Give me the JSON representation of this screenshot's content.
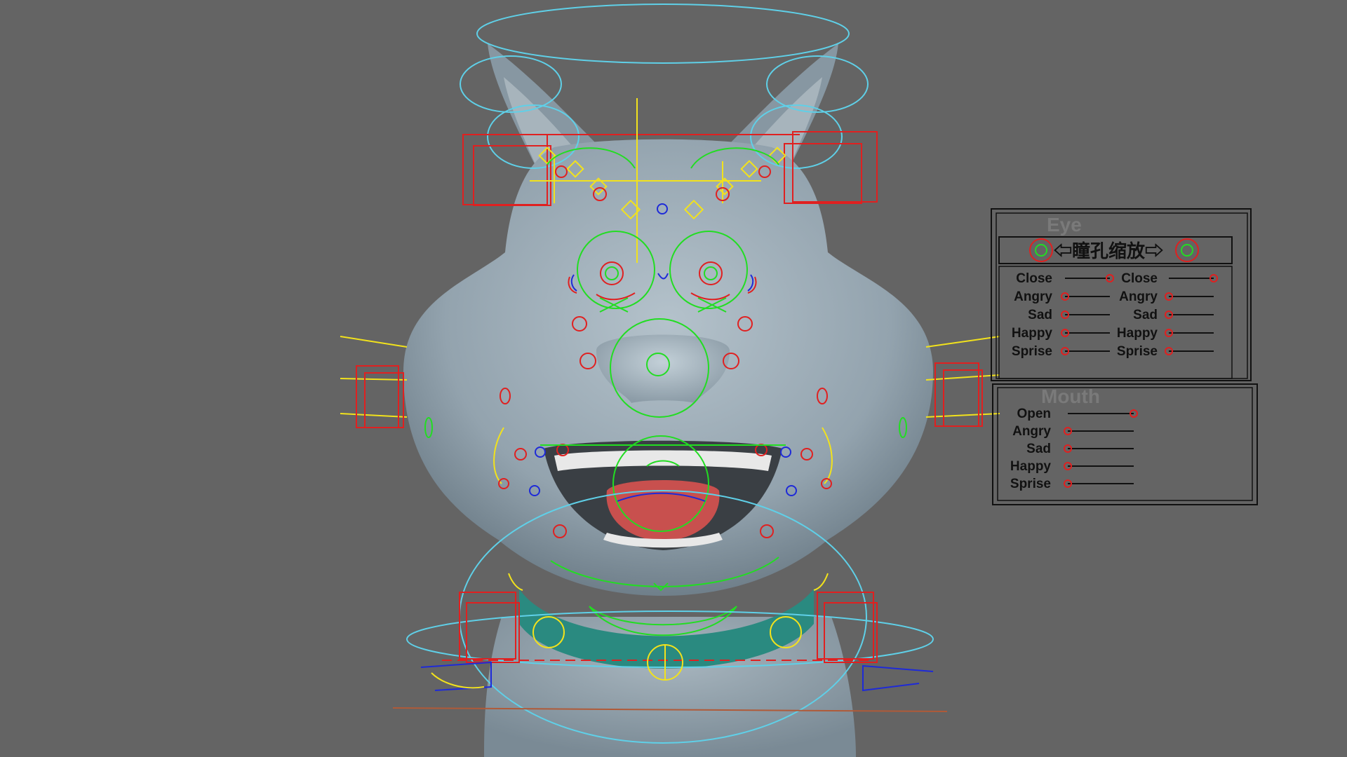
{
  "colors": {
    "viewport_bg": "#646464",
    "skin": "#9aa9b3",
    "control_red": "#e02020",
    "control_green": "#22dd22",
    "control_yellow": "#f2e21c",
    "control_cyan": "#5fd0e8",
    "control_blue": "#1e2ad8",
    "collar": "#2a8a80",
    "tongue": "#c8504e"
  },
  "eye_panel": {
    "title": "Eye",
    "pupil_label": "⇦瞳孔缩放⇨",
    "left": [
      {
        "label": "Close",
        "value": 1.0
      },
      {
        "label": "Angry",
        "value": 0.0
      },
      {
        "label": "Sad",
        "value": 0.0
      },
      {
        "label": "Happy",
        "value": 0.0
      },
      {
        "label": "Sprise",
        "value": 0.0
      }
    ],
    "right": [
      {
        "label": "Close",
        "value": 1.0
      },
      {
        "label": "Angry",
        "value": 0.0
      },
      {
        "label": "Sad",
        "value": 0.0
      },
      {
        "label": "Happy",
        "value": 0.0
      },
      {
        "label": "Sprise",
        "value": 0.0
      }
    ]
  },
  "mouth_panel": {
    "title": "Mouth",
    "sliders": [
      {
        "label": "Open",
        "value": 1.0
      },
      {
        "label": "Angry",
        "value": 0.0
      },
      {
        "label": "Sad",
        "value": 0.0
      },
      {
        "label": "Happy",
        "value": 0.0
      },
      {
        "label": "Sprise",
        "value": 0.0
      }
    ]
  }
}
